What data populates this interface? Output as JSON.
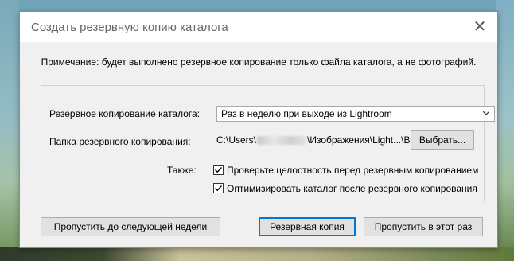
{
  "dialog": {
    "title": "Создать резервную копию каталога",
    "note": "Примечание: будет выполнено резервное копирование только файла каталога, а не фотографий."
  },
  "backup": {
    "frequency_label": "Резервное копирование каталога:",
    "frequency_value": "Раз в неделю при выходе из Lightroom",
    "folder_label": "Папка резервного копирования:",
    "folder_path_start": "C:\\Users\\",
    "folder_path_end": "\\Изображения\\Light...\\Backups",
    "choose_button": "Выбрать..."
  },
  "also": {
    "label": "Также:",
    "options": [
      {
        "label": "Проверьте целостность перед резервным копированием",
        "checked": true
      },
      {
        "label": "Оптимизировать каталог после резервного копирования",
        "checked": true
      }
    ]
  },
  "buttons": {
    "skip_week": "Пропустить до следующей недели",
    "backup": "Резервная копия",
    "skip_once": "Пропустить в этот раз"
  },
  "colors": {
    "default_button_border": "#0078d7",
    "dialog_bg": "#f0f0f0"
  }
}
